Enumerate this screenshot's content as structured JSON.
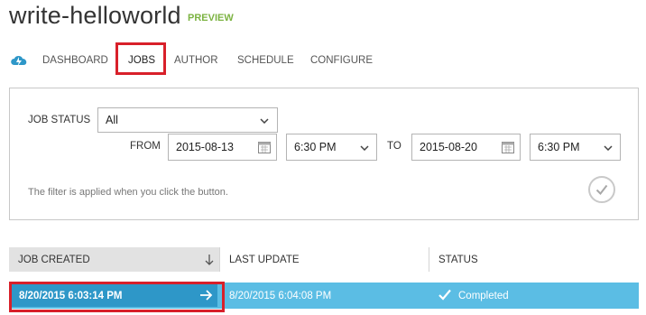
{
  "page": {
    "title": "write-helloworld",
    "badge": "PREVIEW"
  },
  "tabs": [
    {
      "label": "DASHBOARD"
    },
    {
      "label": "JOBS"
    },
    {
      "label": "AUTHOR"
    },
    {
      "label": "SCHEDULE"
    },
    {
      "label": "CONFIGURE"
    }
  ],
  "filter": {
    "job_status_label": "JOB STATUS",
    "job_status_value": "All",
    "from_label": "FROM",
    "from_date": "2015-08-13",
    "from_time": "6:30 PM",
    "to_label": "TO",
    "to_date": "2015-08-20",
    "to_time": "6:30 PM",
    "hint": "The filter is applied when you click the button.",
    "apply_icon": "check-icon"
  },
  "table": {
    "columns": [
      "JOB CREATED",
      "LAST UPDATE",
      "STATUS"
    ],
    "sort_icon": "arrow-down-icon",
    "rows": [
      {
        "job_created": "8/20/2015 6:03:14 PM",
        "last_update": "8/20/2015 6:04:08 PM",
        "status": "Completed"
      }
    ]
  },
  "colors": {
    "accent": "#5bbde4",
    "selected": "#2e97c8",
    "highlight": "#d8202a",
    "preview": "#7cb342"
  }
}
